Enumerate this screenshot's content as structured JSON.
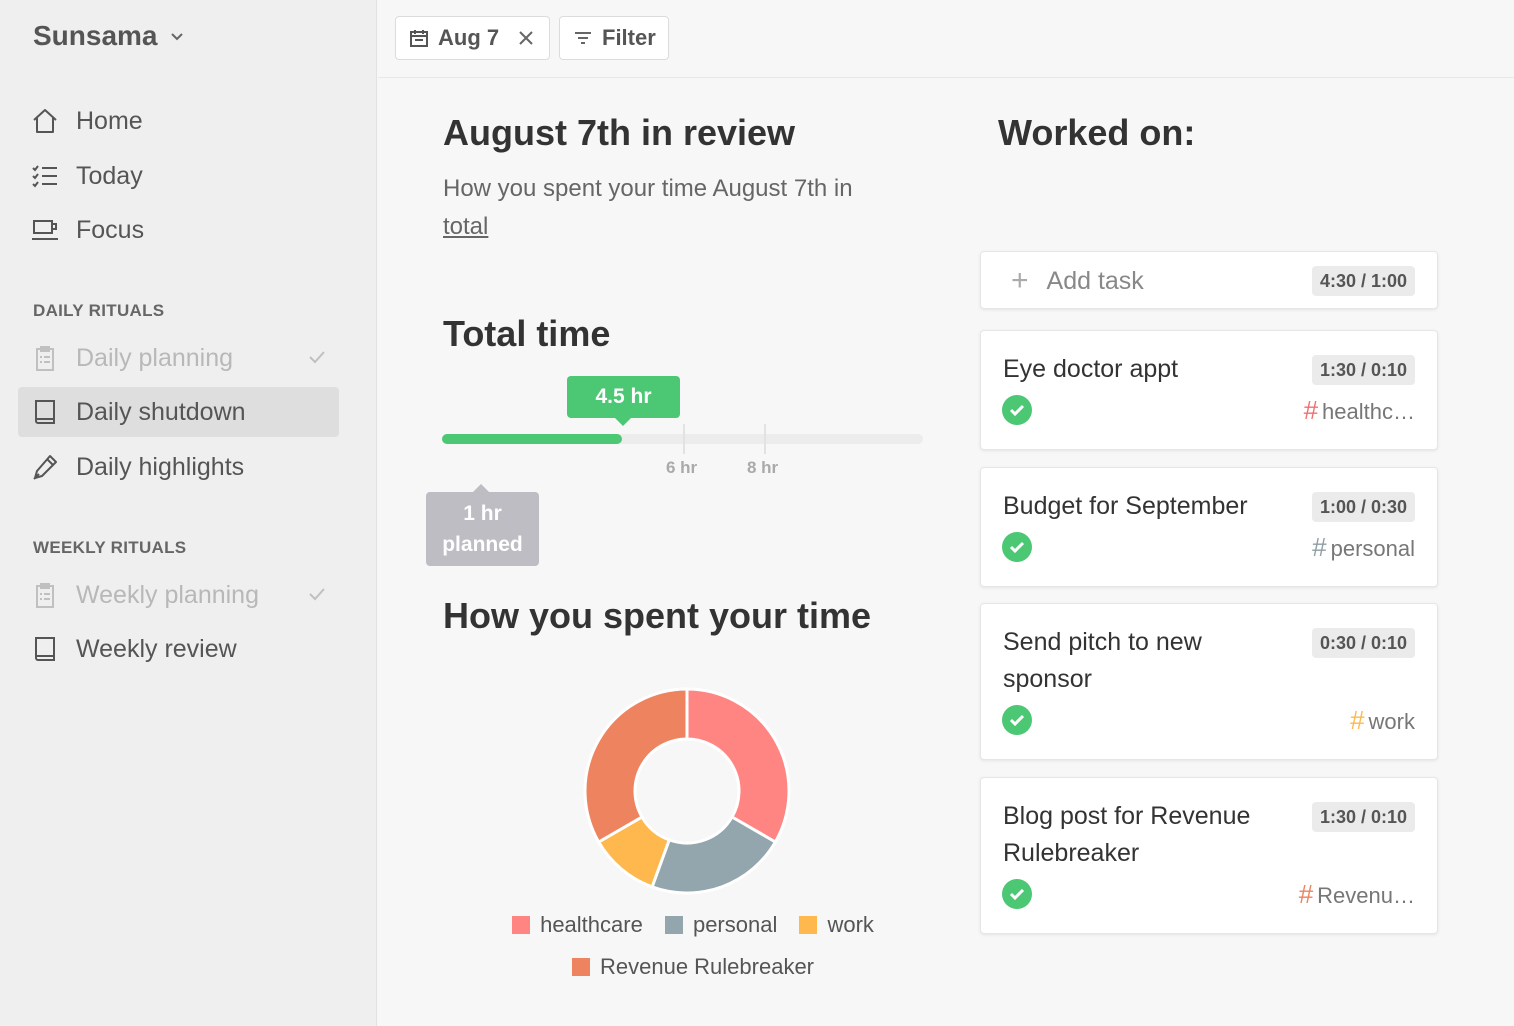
{
  "sidebar": {
    "brand": "Sunsama",
    "nav": [
      {
        "label": "Home",
        "icon": "home-icon"
      },
      {
        "label": "Today",
        "icon": "checklist-icon"
      },
      {
        "label": "Focus",
        "icon": "mug-icon"
      }
    ],
    "daily_label": "DAILY RITUALS",
    "daily": [
      {
        "label": "Daily planning",
        "icon": "clipboard-icon",
        "done": true
      },
      {
        "label": "Daily shutdown",
        "icon": "book-icon",
        "active": true
      },
      {
        "label": "Daily highlights",
        "icon": "pen-icon"
      }
    ],
    "weekly_label": "WEEKLY RITUALS",
    "weekly": [
      {
        "label": "Weekly planning",
        "icon": "clipboard-icon",
        "done": true
      },
      {
        "label": "Weekly review",
        "icon": "book-icon"
      }
    ]
  },
  "topbar": {
    "date_chip": "Aug 7",
    "filter_chip": "Filter"
  },
  "review": {
    "title": "August 7th in review",
    "subtitle": "How you spent your time August 7th in",
    "subtitle_link": "total",
    "total_title": "Total time",
    "actual_label": "4.5 hr",
    "planned_line1": "1 hr",
    "planned_line2": "planned",
    "tick_6": "6 hr",
    "tick_8": "8 hr",
    "progress": {
      "actual_hr": 4.5,
      "max_hr": 12
    },
    "spent_title": "How you spent your time"
  },
  "chart_data": {
    "type": "pie",
    "donut": true,
    "categories": [
      "healthcare",
      "personal",
      "work",
      "Revenue Rulebreaker"
    ],
    "values": [
      1.5,
      1.0,
      0.5,
      1.5
    ],
    "colors": [
      "#ff8583",
      "#93a5ad",
      "#ffb84d",
      "#ee8360"
    ],
    "legend": "bottom"
  },
  "worked": {
    "title": "Worked on:",
    "add_task": "Add task",
    "add_time": "4:30 / 1:00",
    "tasks": [
      {
        "title": "Eye doctor appt",
        "time": "1:30 / 0:10",
        "tag": "healthc…",
        "tag_color": "#f07070"
      },
      {
        "title": "Budget for September",
        "time": "1:00 / 0:30",
        "tag": "personal",
        "tag_color": "#8e9ea6"
      },
      {
        "title": "Send pitch to new sponsor",
        "time": "0:30 / 0:10",
        "tag": "work",
        "tag_color": "#ffb84d"
      },
      {
        "title": "Blog post for Revenue Rulebreaker",
        "time": "1:30 / 0:10",
        "tag": "Revenu…",
        "tag_color": "#ee8360"
      }
    ]
  }
}
